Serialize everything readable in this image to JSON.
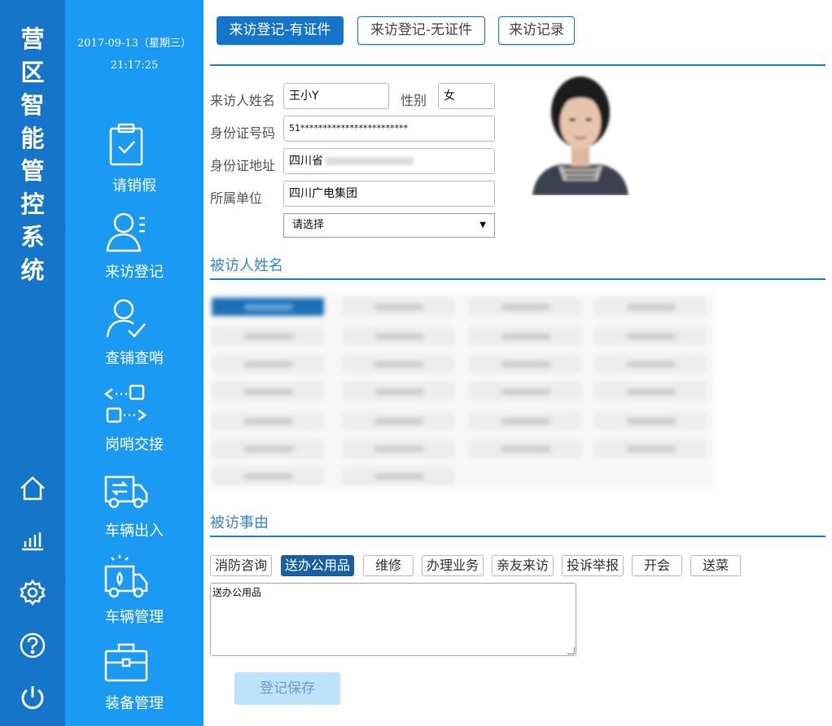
{
  "brand": {
    "title_chars": [
      "营",
      "区",
      "智",
      "能",
      "管",
      "控",
      "系",
      "统"
    ]
  },
  "header": {
    "date": "2017-09-13（星期三）",
    "time": "21:17:25"
  },
  "nav": {
    "items": [
      {
        "label": "请销假",
        "icon": "clipboard-check-icon"
      },
      {
        "label": "来访登记",
        "icon": "visitor-register-icon"
      },
      {
        "label": "查铺查哨",
        "icon": "user-check-icon"
      },
      {
        "label": "岗哨交接",
        "icon": "handover-icon"
      },
      {
        "label": "车辆出入",
        "icon": "truck-inout-icon"
      },
      {
        "label": "车辆管理",
        "icon": "truck-alert-icon"
      },
      {
        "label": "装备管理",
        "icon": "briefcase-icon"
      }
    ]
  },
  "util": [
    "home-icon",
    "stats-icon",
    "settings-icon",
    "help-icon",
    "power-icon"
  ],
  "tabs": [
    {
      "label": "来访登记-有证件"
    },
    {
      "label": "来访登记-无证件"
    },
    {
      "label": "来访记录"
    }
  ],
  "form": {
    "name_label": "来访人姓名",
    "name_value": "王小Y",
    "gender_label": "性别",
    "gender_value": "女",
    "id_label": "身份证号码",
    "id_value": "51************************",
    "addr_label": "身份证地址",
    "addr_value": "四川省",
    "unit_label": "所属单位",
    "unit_value": "四川广电集团",
    "select_value": "请选择"
  },
  "visitee": {
    "title": "被访人姓名"
  },
  "reason": {
    "title": "被访事由",
    "options": [
      "消防咨询",
      "送办公用品",
      "维修",
      "办理业务",
      "亲友来访",
      "投诉举报",
      "开会",
      "送菜"
    ],
    "selected": "送办公用品",
    "text": "送办公用品"
  },
  "save_label": "登记保存",
  "colors": {
    "strip": "#1576c9",
    "nav": "#1a9af2",
    "accent": "#1a82d6"
  }
}
